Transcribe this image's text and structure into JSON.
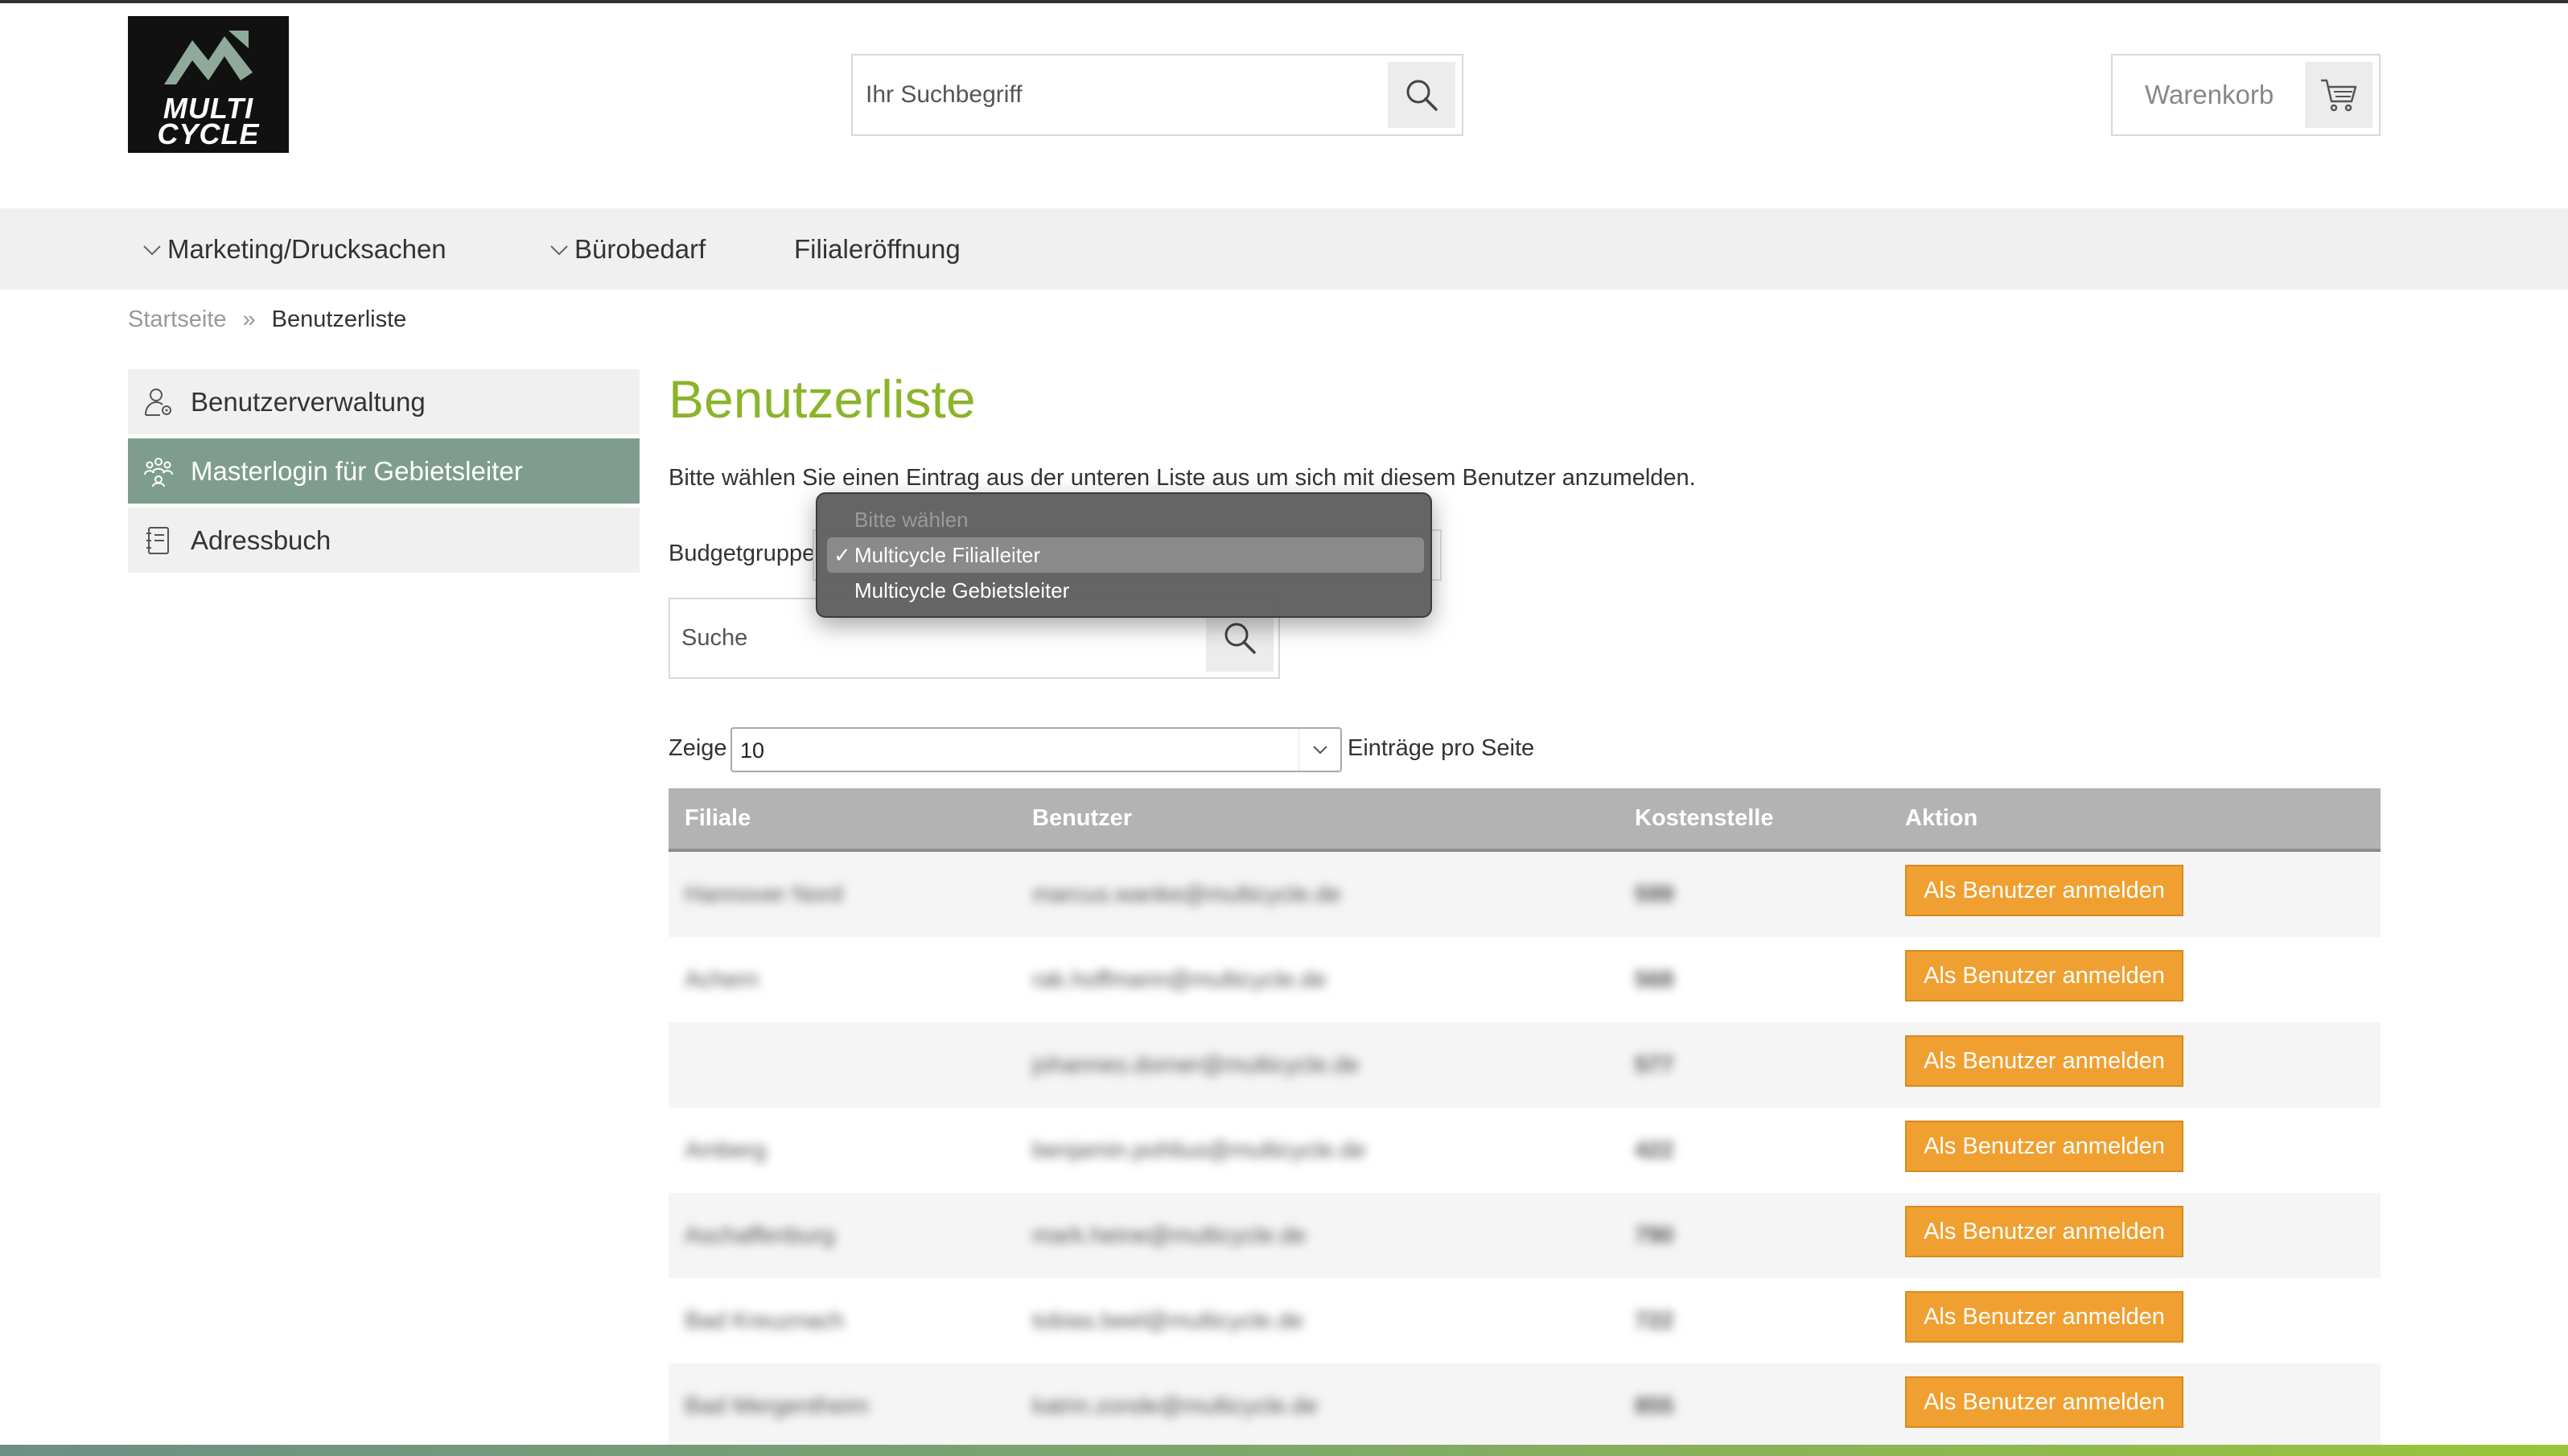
{
  "header": {
    "logo_line1": "MULTI",
    "logo_line2": "CYCLE",
    "search_placeholder": "Ihr Suchbegriff",
    "cart_label": "Warenkorb"
  },
  "nav": {
    "items": [
      {
        "label": "Marketing/Drucksachen",
        "has_dropdown": true
      },
      {
        "label": "Bürobedarf",
        "has_dropdown": true
      },
      {
        "label": "Filialeröffnung",
        "has_dropdown": false
      }
    ]
  },
  "breadcrumb": {
    "home": "Startseite",
    "separator": "»",
    "current": "Benutzerliste"
  },
  "sidebar": {
    "items": [
      {
        "label": "Benutzerverwaltung",
        "icon": "user-gear-icon",
        "active": false
      },
      {
        "label": "Masterlogin für Gebietsleiter",
        "icon": "users-group-icon",
        "active": true
      },
      {
        "label": "Adressbuch",
        "icon": "address-book-icon",
        "active": false
      }
    ]
  },
  "main": {
    "title": "Benutzerliste",
    "intro": "Bitte wählen Sie einen Eintrag aus der unteren Liste aus um sich mit diesem Benutzer anzumelden.",
    "budgetgroup_label": "Budgetgruppe",
    "dropdown_options": [
      {
        "label": "Bitte wählen",
        "disabled": true,
        "selected": false
      },
      {
        "label": "Multicycle Filialleiter",
        "disabled": false,
        "selected": true
      },
      {
        "label": "Multicycle Gebietsleiter",
        "disabled": false,
        "selected": false
      }
    ],
    "search_placeholder": "Suche",
    "show_label": "Zeige",
    "show_value": "10",
    "entries_label": "Einträge pro Seite"
  },
  "table": {
    "columns": [
      "Filiale",
      "Benutzer",
      "Kostenstelle",
      "Aktion"
    ],
    "action_label": "Als Benutzer anmelden",
    "rows": [
      {
        "filiale": "Hannover Nord",
        "benutzer": "marcus.wanke@multicycle.de",
        "kostenstelle": "599"
      },
      {
        "filiale": "Achern",
        "benutzer": "rak.hoffmann@multicycle.de",
        "kostenstelle": "568"
      },
      {
        "filiale": "",
        "benutzer": "johannes.dorner@multicycle.de",
        "kostenstelle": "577"
      },
      {
        "filiale": "Amberg",
        "benutzer": "benjamin.pohlius@multicycle.de",
        "kostenstelle": "422"
      },
      {
        "filiale": "Aschaffenburg",
        "benutzer": "mark.heine@multicycle.de",
        "kostenstelle": "790"
      },
      {
        "filiale": "Bad Kreuznach",
        "benutzer": "tobias.beel@multicycle.de",
        "kostenstelle": "722"
      },
      {
        "filiale": "Bad Mergentheim",
        "benutzer": "katrin.zonde@multicycle.de",
        "kostenstelle": "855"
      }
    ]
  },
  "colors": {
    "accent_green": "#8bb42b",
    "sidebar_active": "#7f9d8f",
    "button_orange": "#f0a030",
    "table_header": "#b3b3b3"
  }
}
